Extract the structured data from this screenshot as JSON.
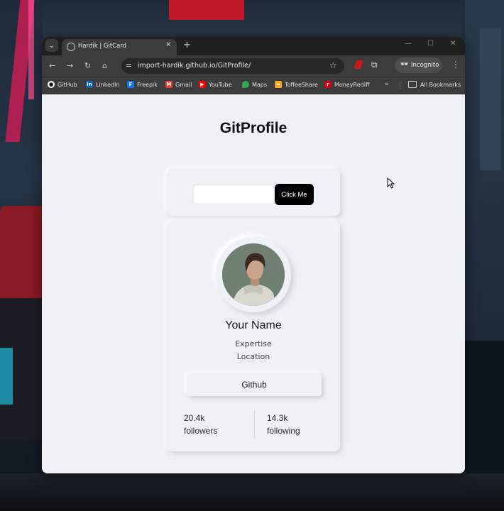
{
  "browser": {
    "tab_title": "Hardik | GitCard",
    "url": "import-hardik.github.io/GitProfile/",
    "incognito_label": "Incognito",
    "bookmarks": [
      {
        "label": "GitHub",
        "icon": "github-icon",
        "color": "#ffffff"
      },
      {
        "label": "LinkedIn",
        "icon": "linkedin-icon",
        "color": "#0a66c2"
      },
      {
        "label": "Freepik",
        "icon": "freepik-icon",
        "color": "#1273eb"
      },
      {
        "label": "Gmail",
        "icon": "gmail-icon",
        "color": "#ea4335"
      },
      {
        "label": "YouTube",
        "icon": "youtube-icon",
        "color": "#ff0000"
      },
      {
        "label": "Maps",
        "icon": "maps-icon",
        "color": "#34a853"
      },
      {
        "label": "ToffeeShare",
        "icon": "toffeeshare-icon",
        "color": "#f5a623"
      },
      {
        "label": "MoneyRediff",
        "icon": "rediff-icon",
        "color": "#d0021b"
      }
    ],
    "all_bookmarks_label": "All Bookmarks",
    "more_bookmarks": "»"
  },
  "page": {
    "title": "GitProfile",
    "search": {
      "value": "",
      "placeholder": ""
    },
    "click_button": "Click Me",
    "profile": {
      "name": "Your Name",
      "expertise": "Expertise",
      "location": "Location",
      "github_button": "Github",
      "followers_count": "20.4k",
      "followers_label": "followers",
      "following_count": "14.3k",
      "following_label": "following"
    }
  }
}
